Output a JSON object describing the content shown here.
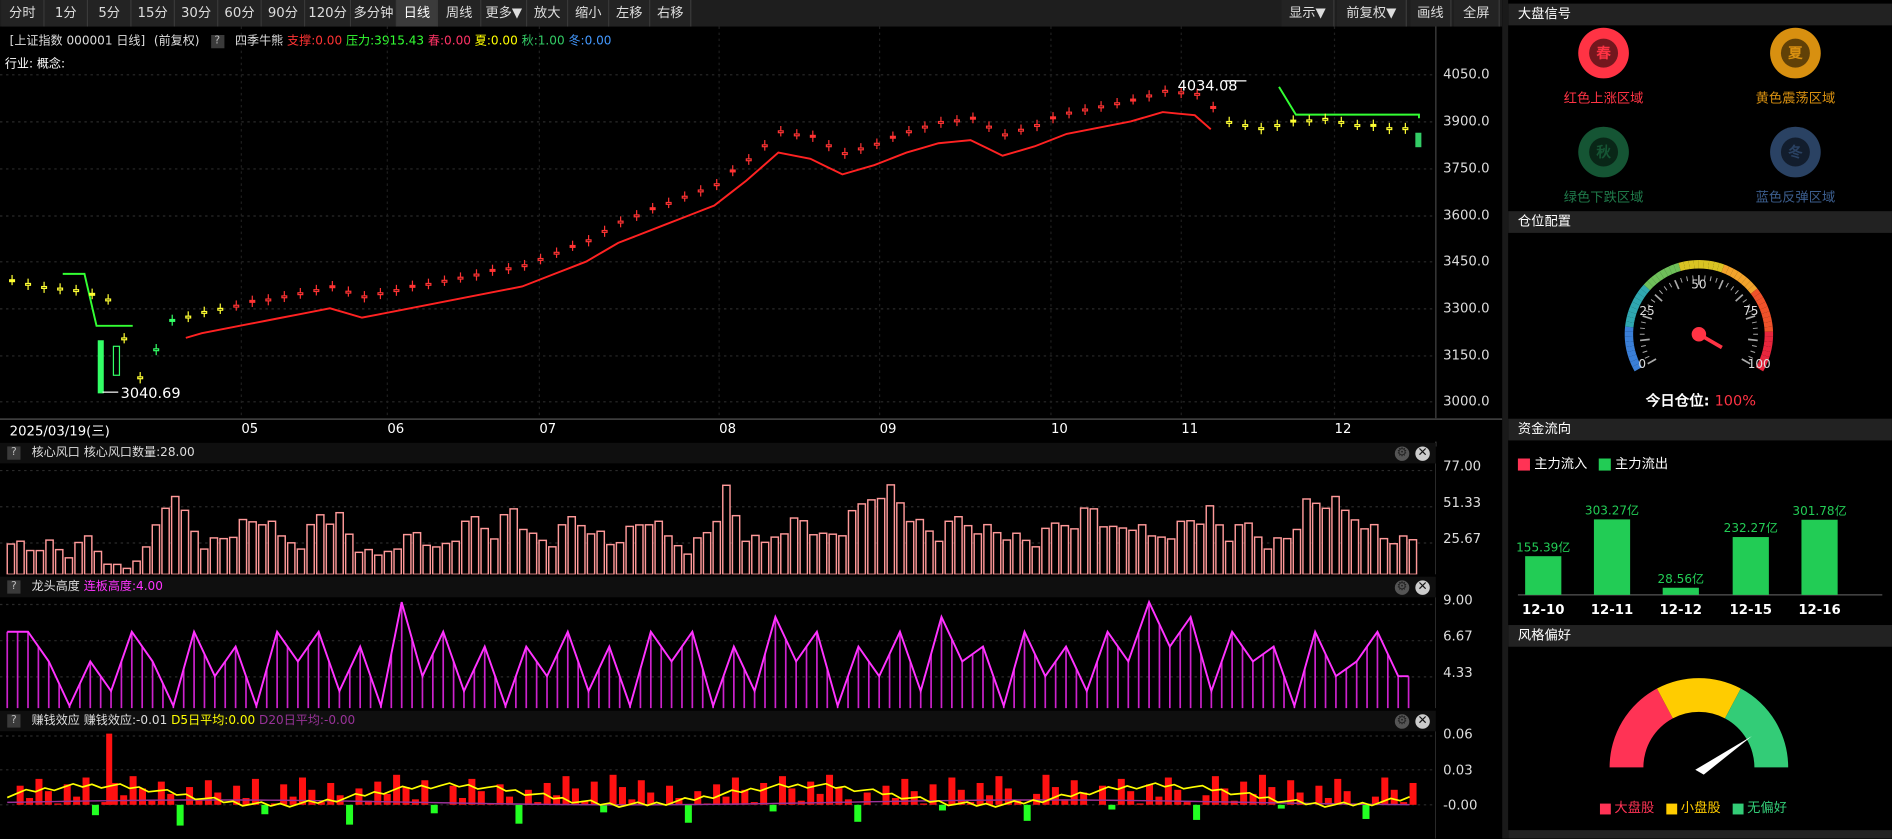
{
  "toolbar": {
    "period_buttons": [
      "分时",
      "1分",
      "5分",
      "15分",
      "30分",
      "60分",
      "90分",
      "120分",
      "多分钟",
      "日线",
      "周线",
      "更多▼",
      "放大",
      "缩小",
      "左移",
      "右移"
    ],
    "active": "日线",
    "right_buttons": [
      "显示▼",
      "前复权▼",
      "画线",
      "全屏"
    ]
  },
  "header": {
    "prefix": "[上证指数 000001 日线]",
    "adj": "(前复权)",
    "indicator": "四季牛熊",
    "support": "支撑:0.00",
    "pressure": "压力:3915.43",
    "spring": "春:0.00",
    "summer": "夏:0.00",
    "autumn": "秋:1.00",
    "winter": "冬:0.00",
    "industry": "行业: 概念:"
  },
  "main_chart": {
    "y_ticks": [
      "4050.0",
      "3900.0",
      "3750.0",
      "3600.0",
      "3450.0",
      "3300.0",
      "3150.0",
      "3000.0"
    ],
    "high_label": "4034.08",
    "low_label": "3040.69",
    "date_label": "2025/03/19(三)",
    "x_ticks": [
      "05",
      "06",
      "07",
      "08",
      "09",
      "10",
      "11",
      "12"
    ]
  },
  "sub_charts": {
    "core": {
      "name": "核心风口",
      "value": "核心风口数量:28.00",
      "ticks": [
        "77.00",
        "51.33",
        "25.67"
      ]
    },
    "dragon": {
      "name": "龙头高度",
      "value": "连板高度:4.00",
      "ticks": [
        "9.00",
        "6.67",
        "4.33"
      ]
    },
    "money": {
      "name": "赚钱效应",
      "value": "赚钱效应:-0.01",
      "d5": "D5日平均:0.00",
      "d20": "D20日平均:-0.00",
      "ticks": [
        "0.06",
        "0.03",
        "-0.00"
      ]
    }
  },
  "right_panel": {
    "market_signal": {
      "title": "大盘信号",
      "items": [
        {
          "glyph": "春",
          "label": "红色上涨区域",
          "color": "#ff3344"
        },
        {
          "glyph": "夏",
          "label": "黄色震荡区域",
          "color": "#d89010"
        },
        {
          "glyph": "秋",
          "label": "绿色下跌区域",
          "color": "#1f7a4a"
        },
        {
          "glyph": "冬",
          "label": "蓝色反弹区域",
          "color": "#3c5e8e"
        }
      ]
    },
    "position": {
      "title": "仓位配置",
      "ticks": [
        "0",
        "25",
        "50",
        "75",
        "100"
      ],
      "today_label": "今日仓位:",
      "today_value": "100%",
      "value": 100
    },
    "fund_flow": {
      "title": "资金流向",
      "legend_in": "主力流入",
      "legend_out": "主力流出",
      "dates": [
        "12-10",
        "12-11",
        "12-12",
        "12-15",
        "12-16"
      ],
      "labels": [
        "155.39亿",
        "303.27亿",
        "28.56亿",
        "232.27亿",
        "301.78亿"
      ],
      "values": [
        155.39,
        303.27,
        28.56,
        232.27,
        301.78
      ]
    },
    "style": {
      "title": "风格偏好",
      "legend": [
        "大盘股",
        "小盘股",
        "无偏好"
      ],
      "colors": [
        "#ff3355",
        "#ffcc00",
        "#33cc77"
      ]
    }
  },
  "chart_data": [
    {
      "type": "candlestick",
      "title": "上证指数 000001 日线",
      "ylim": [
        3000,
        4050
      ],
      "x_ticks": [
        "05",
        "06",
        "07",
        "08",
        "09",
        "10",
        "11",
        "12"
      ],
      "annotations": [
        "4034.08",
        "3040.69"
      ],
      "approx_close_path": [
        3390,
        3370,
        3360,
        3330,
        3080,
        3260,
        3290,
        3310,
        3330,
        3350,
        3370,
        3340,
        3360,
        3380,
        3400,
        3420,
        3440,
        3480,
        3520,
        3580,
        3620,
        3660,
        3700,
        3780,
        3870,
        3850,
        3800,
        3830,
        3870,
        3900,
        3910,
        3860,
        3890,
        3930,
        3950,
        3970,
        4000,
        3990,
        3900,
        3880,
        3900,
        3910,
        3890,
        3880
      ]
    },
    {
      "type": "bar",
      "title": "核心风口",
      "ylim": [
        0,
        77
      ],
      "approx_values": [
        30,
        20,
        25,
        15,
        30,
        10,
        5,
        20,
        60,
        50,
        25,
        30,
        40,
        45,
        30,
        25,
        50,
        45,
        20,
        15,
        25,
        35,
        20,
        30,
        45,
        35,
        55,
        30,
        25,
        45,
        40,
        25,
        35,
        45,
        30,
        20,
        35,
        65,
        30,
        25,
        40,
        45,
        30,
        35,
        55,
        75,
        60,
        40,
        30,
        45,
        40,
        35,
        30,
        25,
        40,
        45,
        55,
        35,
        40,
        30,
        35,
        45,
        50,
        30,
        40,
        25,
        30,
        55,
        60,
        50,
        45,
        30,
        28
      ]
    },
    {
      "type": "line",
      "title": "龙头高度",
      "ylim": [
        2,
        9
      ],
      "approx_values": [
        7,
        7,
        5,
        2,
        5,
        3,
        7,
        5,
        2,
        7,
        4,
        6,
        2,
        7,
        5,
        7,
        3,
        6,
        2,
        9,
        4,
        7,
        3,
        6,
        2,
        6,
        4,
        7,
        3,
        6,
        2,
        7,
        5,
        7,
        2,
        6,
        3,
        8,
        5,
        7,
        2,
        6,
        4,
        7,
        3,
        8,
        5,
        6,
        2,
        7,
        4,
        6,
        3,
        7,
        5,
        9,
        6,
        8,
        3,
        7,
        5,
        6,
        2,
        7,
        4,
        5,
        7,
        4
      ]
    },
    {
      "type": "bar",
      "title": "赚钱效应",
      "ylim": [
        -0.02,
        0.06
      ],
      "series": [
        {
          "name": "D5日平均",
          "color": "#ffff00"
        },
        {
          "name": "D20日平均",
          "color": "#993399"
        }
      ]
    }
  ]
}
